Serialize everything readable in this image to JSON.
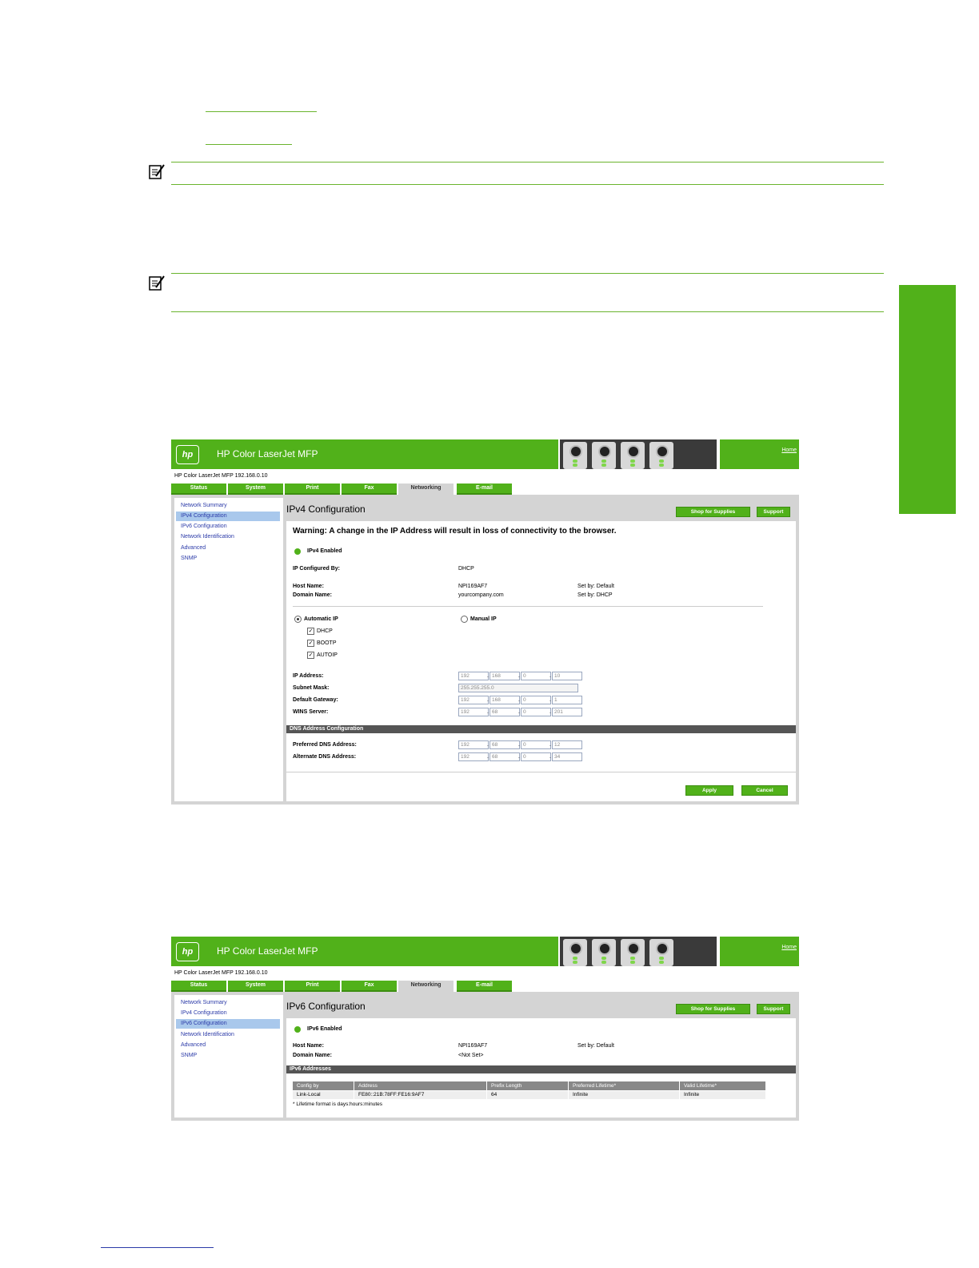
{
  "doc": {
    "side_tab_color": "#51b11a",
    "accent": "#6ab42e"
  },
  "ipv4": {
    "app_title": "HP Color LaserJet MFP",
    "home_link": "Home",
    "breadcrumb": "HP Color LaserJet MFP   192.168.0.10",
    "tabs": [
      "Status",
      "System",
      "Print",
      "Fax",
      "Networking",
      "E-mail"
    ],
    "active_tab": "Networking",
    "nav": [
      "Network Summary",
      "IPv4 Configuration",
      "IPv6 Configuration",
      "Network Identification",
      "Advanced",
      "SNMP"
    ],
    "active_nav": "IPv4 Configuration",
    "title": "IPv4 Configuration",
    "shop_button": "Shop for Supplies",
    "support_button": "Support",
    "warning": "Warning: A change in the IP Address will result in loss of connectivity to the browser.",
    "enabled_label": "IPv4 Enabled",
    "configured_by_label": "IP Configured By:",
    "configured_by_value": "DHCP",
    "host_name_label": "Host Name:",
    "host_name_value": "NPI169AF7",
    "host_set_by": "Set by:  Default",
    "domain_name_label": "Domain Name:",
    "domain_name_value": "yourcompany.com",
    "domain_set_by": "Set by:  DHCP",
    "automatic_ip_label": "Automatic IP",
    "manual_ip_label": "Manual IP",
    "options": [
      "DHCP",
      "BOOTP",
      "AUTOIP"
    ],
    "ip_address_label": "IP Address:",
    "ip_address": [
      "192",
      "168",
      "0",
      "10"
    ],
    "subnet_mask_label": "Subnet Mask:",
    "subnet_mask": "255.255.255.0",
    "gateway_label": "Default Gateway:",
    "gateway": [
      "192",
      "168",
      "0",
      "1"
    ],
    "wins_label": "WINS Server:",
    "wins": [
      "192",
      "68",
      "0",
      "201"
    ],
    "dns_section": "DNS Address Configuration",
    "preferred_dns_label": "Preferred DNS Address:",
    "preferred_dns": [
      "192",
      "68",
      "0",
      "12"
    ],
    "alternate_dns_label": "Alternate DNS Address:",
    "alternate_dns": [
      "192",
      "68",
      "0",
      "34"
    ],
    "apply_button": "Apply",
    "cancel_button": "Cancel"
  },
  "ipv6": {
    "app_title": "HP Color LaserJet MFP",
    "home_link": "Home",
    "breadcrumb": "HP Color LaserJet MFP   192.168.0.10",
    "tabs": [
      "Status",
      "System",
      "Print",
      "Fax",
      "Networking",
      "E-mail"
    ],
    "active_tab": "Networking",
    "nav": [
      "Network Summary",
      "IPv4 Configuration",
      "IPv6 Configuration",
      "Network Identification",
      "Advanced",
      "SNMP"
    ],
    "active_nav": "IPv6 Configuration",
    "title": "IPv6 Configuration",
    "shop_button": "Shop for Supplies",
    "support_button": "Support",
    "enabled_label": "IPv6 Enabled",
    "host_name_label": "Host Name:",
    "host_name_value": "NPI169AF7",
    "host_set_by": "Set by:  Default",
    "domain_name_label": "Domain Name:",
    "domain_name_value": "<Not Set>",
    "addresses_section": "IPv6 Addresses",
    "table_headers": [
      "Config by",
      "Address",
      "Prefix Length",
      "Preferred Lifetime*",
      "Valid Lifetime*"
    ],
    "table_row": [
      "Link-Local",
      "FE80::21B:78FF:FE16:9AF7",
      "64",
      "Infinite",
      "Infinite"
    ],
    "footnote": "* Lifetime format is days:hours:minutes"
  }
}
